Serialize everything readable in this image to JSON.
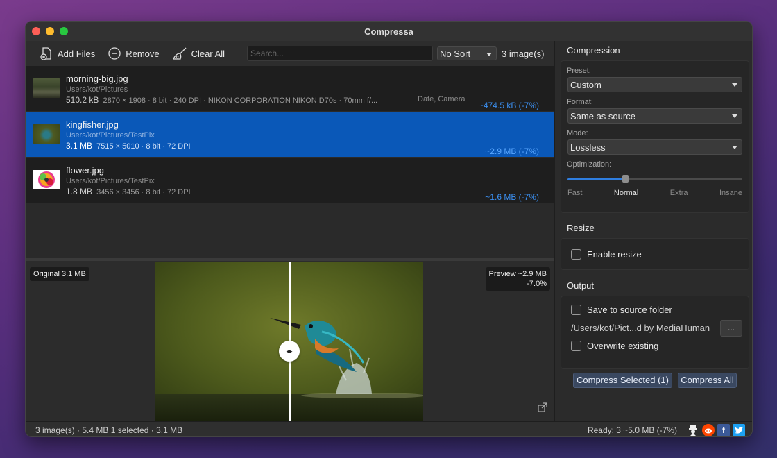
{
  "window": {
    "title": "Compressa"
  },
  "toolbar": {
    "add_files": "Add Files",
    "remove": "Remove",
    "clear_all": "Clear All",
    "search_placeholder": "Search...",
    "sort_value": "No Sort",
    "count": "3 image(s)"
  },
  "files": [
    {
      "name": "morning-big.jpg",
      "path": "Users/kot/Pictures",
      "size": "510.2 kB",
      "meta": "2870 × 1908  ·  8 bit  ·  240 DPI  ·  NIKON CORPORATION NIKON D70s  ·  70mm  f/...",
      "extra": "Date, Camera",
      "saving": "~474.5 kB (-7%)"
    },
    {
      "name": "kingfisher.jpg",
      "path": "Users/kot/Pictures/TestPix",
      "size": "3.1 MB",
      "meta": "7515 × 5010  ·  8 bit  ·  72 DPI",
      "saving": "~2.9 MB (-7%)"
    },
    {
      "name": "flower.jpg",
      "path": "Users/kot/Pictures/TestPix",
      "size": "1.8 MB",
      "meta": "3456 × 3456  ·  8 bit  ·  72 DPI",
      "saving": "~1.6 MB (-7%)"
    }
  ],
  "preview": {
    "original_label": "Original 3.1 MB",
    "preview_label": "Preview ~2.9 MB",
    "preview_pct": "-7.0%"
  },
  "compression": {
    "heading": "Compression",
    "preset_label": "Preset:",
    "preset_value": "Custom",
    "format_label": "Format:",
    "format_value": "Same as source",
    "mode_label": "Mode:",
    "mode_value": "Lossless",
    "optimization_label": "Optimization:",
    "optimization_level": 0.33,
    "ticks": [
      "Fast",
      "Normal",
      "Extra",
      "Insane"
    ]
  },
  "resize": {
    "heading": "Resize",
    "enable_label": "Enable resize"
  },
  "output": {
    "heading": "Output",
    "save_source_label": "Save to source folder",
    "path": "/Users/kot/Pict...d by MediaHuman",
    "browse_label": "...",
    "overwrite_label": "Overwrite existing"
  },
  "actions": {
    "compress_selected": "Compress Selected (1)",
    "compress_all": "Compress All"
  },
  "status": {
    "left": "3 image(s) · 5.4 MB  1 selected · 3.1 MB",
    "right": "Ready: 3   ~5.0 MB (-7%)"
  },
  "colors": {
    "accent": "#0a58b8",
    "saving_text": "#3b8ff0"
  }
}
